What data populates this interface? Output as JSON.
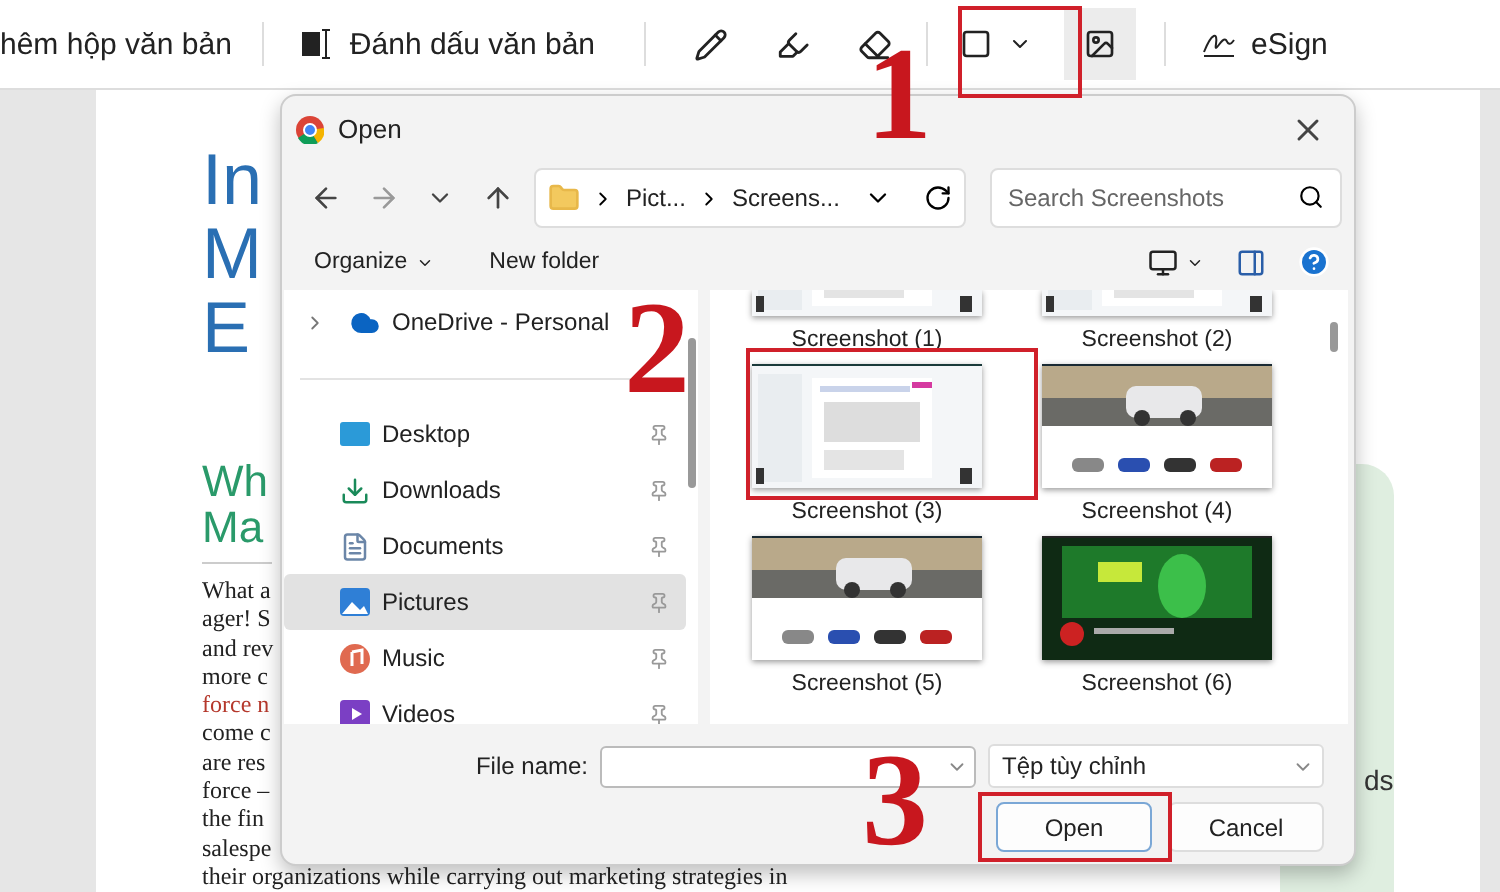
{
  "toolbar": {
    "text_box_label": "hêm hộp văn bản",
    "highlight_label": "Đánh dấu văn bản",
    "image_button_selected": true,
    "esign_label": "eSign"
  },
  "doc": {
    "title_lines": [
      "In",
      "M",
      "E"
    ],
    "subtitle_lines": [
      "Wh",
      "Ma"
    ],
    "body_lines": [
      {
        "text": "What a",
        "emphasis": false
      },
      {
        "text": "ager! S",
        "emphasis": false
      },
      {
        "text": "and rev",
        "emphasis": false
      },
      {
        "text": "more c",
        "emphasis": false
      },
      {
        "text": "force n",
        "emphasis": true
      },
      {
        "text": "come c",
        "emphasis": false
      },
      {
        "text": "are res",
        "emphasis": false
      },
      {
        "text": "force –",
        "emphasis": false
      },
      {
        "text": "the fin",
        "emphasis": false
      },
      {
        "text": "salespe",
        "emphasis": false
      },
      {
        "text": "their organizations while carrying out marketing strategies in",
        "emphasis": false
      }
    ],
    "side_text": "ds"
  },
  "dialog": {
    "title": "Open",
    "path": [
      "Pict...",
      "Screens..."
    ],
    "search": {
      "placeholder": "Search Screenshots"
    },
    "commands": [
      "Organize",
      "New folder"
    ],
    "nav": [
      {
        "label": "OneDrive - Personal",
        "selected": false
      },
      {
        "label": "Desktop",
        "selected": false
      },
      {
        "label": "Downloads",
        "selected": false
      },
      {
        "label": "Documents",
        "selected": false
      },
      {
        "label": "Pictures",
        "selected": true
      },
      {
        "label": "Music",
        "selected": false
      },
      {
        "label": "Videos",
        "selected": false
      }
    ],
    "files": [
      {
        "name": "Screenshot (1)",
        "selected": false
      },
      {
        "name": "Screenshot (2)",
        "selected": false
      },
      {
        "name": "Screenshot (3)",
        "selected": false
      },
      {
        "name": "Screenshot (4)",
        "selected": false
      },
      {
        "name": "Screenshot (5)",
        "selected": false
      },
      {
        "name": "Screenshot (6)",
        "selected": false
      }
    ],
    "file_name_label": "File name:",
    "filter": "Tệp tùy chỉnh",
    "buttons": [
      "Open",
      "Cancel"
    ]
  },
  "annotations": [
    "1",
    "2",
    "3"
  ]
}
